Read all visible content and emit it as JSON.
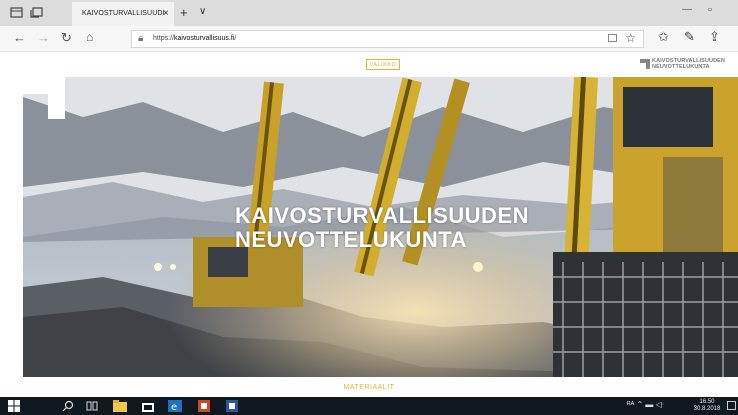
{
  "browser": {
    "tab_title": "KAIVOSTURVALLISUUDI",
    "tab_close": "×",
    "new_tab": "+",
    "tab_menu": "∨",
    "url_host": "kaivosturvallisuus.fi",
    "url_prefix": "https://",
    "url_suffix": "/"
  },
  "page": {
    "menu_label": "VALIKKO",
    "logo_line1": "KAIVOSTURVALLISUUDEN",
    "logo_line2": "NEUVOTTELUKUNTA",
    "hero_line1": "KAIVOSTURVALLISUUDEN",
    "hero_line2": "NEUVOTTELUKUNTA",
    "section_label": "MATERIAALIT"
  },
  "taskbar": {
    "time": "16.50",
    "date": "30.8.2018"
  },
  "colors": {
    "accent": "#e9b23a",
    "taskbar": "#101820"
  }
}
